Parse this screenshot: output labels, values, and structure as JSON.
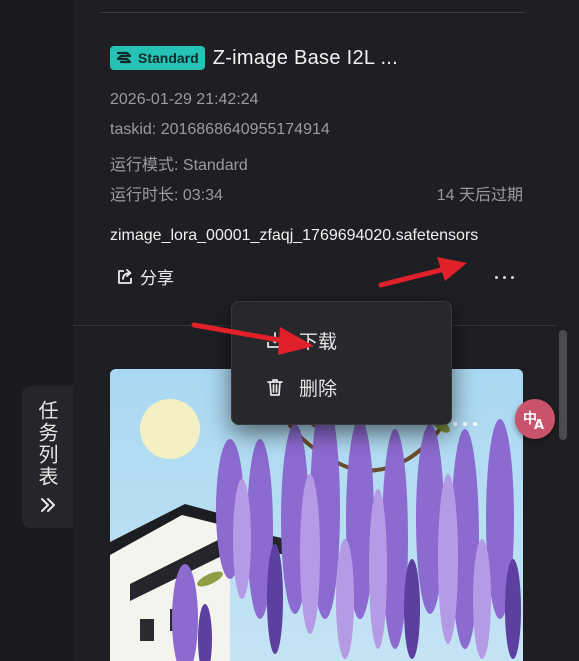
{
  "side_tab": {
    "label": "任务列表"
  },
  "task": {
    "badge_label": "Standard",
    "title": "Z-image Base I2L ...",
    "datetime": "2026-01-29 21:42:24",
    "taskid": "taskid: 2016868640955174914",
    "run_mode": "运行模式: Standard",
    "run_duration": "运行时长: 03:34",
    "expiry": "14 天后过期",
    "filename": "zimage_lora_00001_zfaqj_1769694020.safetensors",
    "share_label": "分享"
  },
  "menu": {
    "items": [
      {
        "label": "下载",
        "icon": "download-icon"
      },
      {
        "label": "删除",
        "icon": "trash-icon"
      }
    ]
  },
  "colors": {
    "background": "#1e1f22",
    "badge": "#25c2b5",
    "arrow": "#e0202a",
    "translate": "#c9536a"
  }
}
